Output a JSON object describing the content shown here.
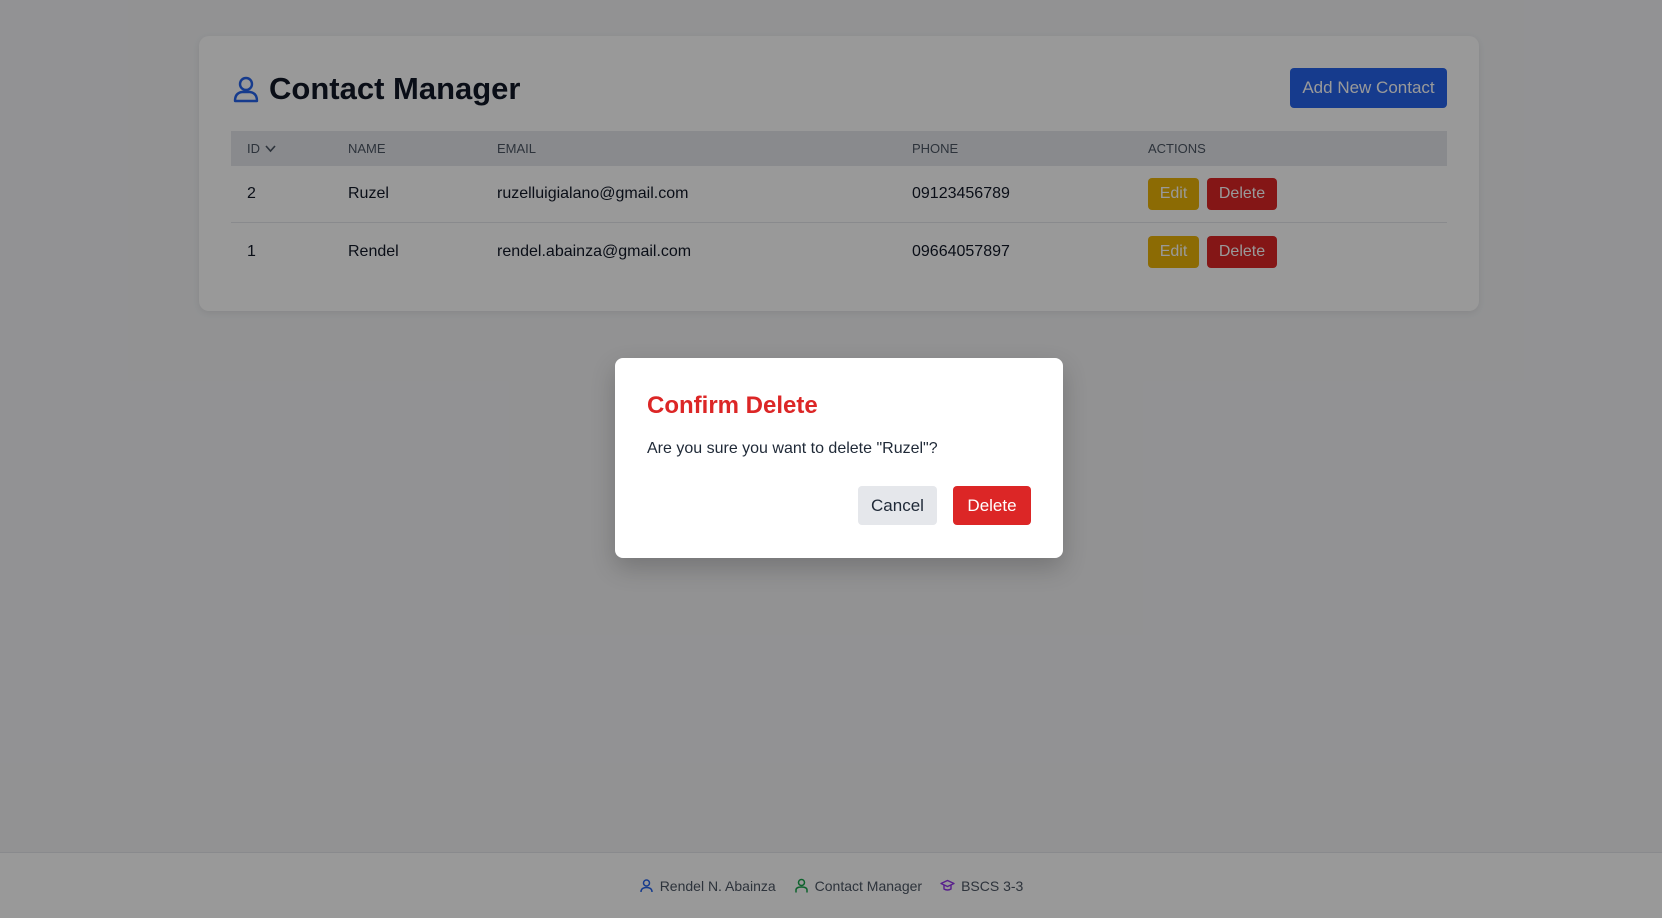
{
  "app": {
    "title": "Contact Manager",
    "add_button": "Add New Contact"
  },
  "table": {
    "headers": {
      "id": "ID",
      "name": "Name",
      "email": "Email",
      "phone": "Phone",
      "actions": "Actions"
    },
    "sort": {
      "column": "id",
      "direction": "desc",
      "icon": "chevron-down-icon"
    },
    "rows": [
      {
        "id": "2",
        "name": "Ruzel",
        "email": "ruzelluigialano@gmail.com",
        "phone": "09123456789",
        "edit_label": "Edit",
        "delete_label": "Delete"
      },
      {
        "id": "1",
        "name": "Rendel",
        "email": "rendel.abainza@gmail.com",
        "phone": "09664057897",
        "edit_label": "Edit",
        "delete_label": "Delete"
      }
    ]
  },
  "modal": {
    "title": "Confirm Delete",
    "message": "Are you sure you want to delete \"Ruzel\"?",
    "cancel_label": "Cancel",
    "confirm_label": "Delete"
  },
  "footer": {
    "items": [
      {
        "label": "Rendel N. Abainza",
        "icon": "user-icon",
        "color": "#2563eb"
      },
      {
        "label": "Contact Manager",
        "icon": "user-icon",
        "color": "#16a34a"
      },
      {
        "label": "BSCS 3-3",
        "icon": "graduation-cap-icon",
        "color": "#9333ea"
      }
    ]
  },
  "colors": {
    "primary": "#2563eb",
    "danger": "#dc2626",
    "warning": "#eab308"
  }
}
